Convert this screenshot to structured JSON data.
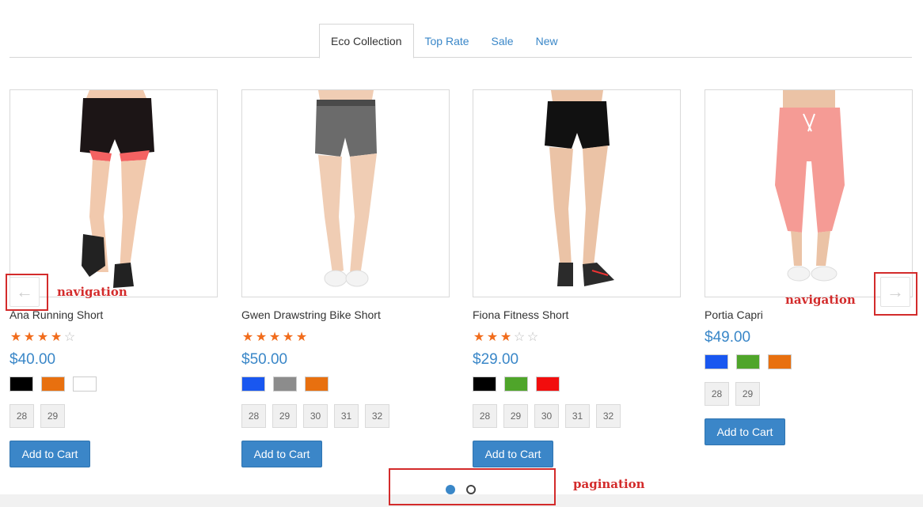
{
  "tabs": [
    {
      "label": "Eco Collection",
      "active": true
    },
    {
      "label": "Top Rate",
      "active": false
    },
    {
      "label": "Sale",
      "active": false
    },
    {
      "label": "New",
      "active": false
    }
  ],
  "products": [
    {
      "name": "Ana Running Short",
      "rating": 4,
      "price": "$40.00",
      "colors": [
        "#000000",
        "#e8700f",
        "#ffffff"
      ],
      "sizes": [
        "28",
        "29"
      ],
      "cart_label": "Add to Cart"
    },
    {
      "name": "Gwen Drawstring Bike Short",
      "rating": 4.7,
      "price": "$50.00",
      "colors": [
        "#1957f0",
        "#8c8c8c",
        "#e8700f"
      ],
      "sizes": [
        "28",
        "29",
        "30",
        "31",
        "32"
      ],
      "cart_label": "Add to Cart"
    },
    {
      "name": "Fiona Fitness Short",
      "rating": 3,
      "price": "$29.00",
      "colors": [
        "#000000",
        "#4fa52a",
        "#f20d0d"
      ],
      "sizes": [
        "28",
        "29",
        "30",
        "31",
        "32"
      ],
      "cart_label": "Add to Cart"
    },
    {
      "name": "Portia Capri",
      "rating": 0,
      "price": "$49.00",
      "colors": [
        "#1957f0",
        "#4fa52a",
        "#e8700f"
      ],
      "sizes": [
        "28",
        "29"
      ],
      "cart_label": "Add to Cart"
    }
  ],
  "annotations": {
    "nav_left": "navigation",
    "nav_right": "navigation",
    "pagination": "pagination"
  },
  "nav": {
    "prev_icon": "arrow-left-icon",
    "next_icon": "arrow-right-icon"
  },
  "pagination": {
    "pages": 2,
    "current": 1
  },
  "accent_color": "#3a87c8",
  "star_color": "#f16c1c"
}
